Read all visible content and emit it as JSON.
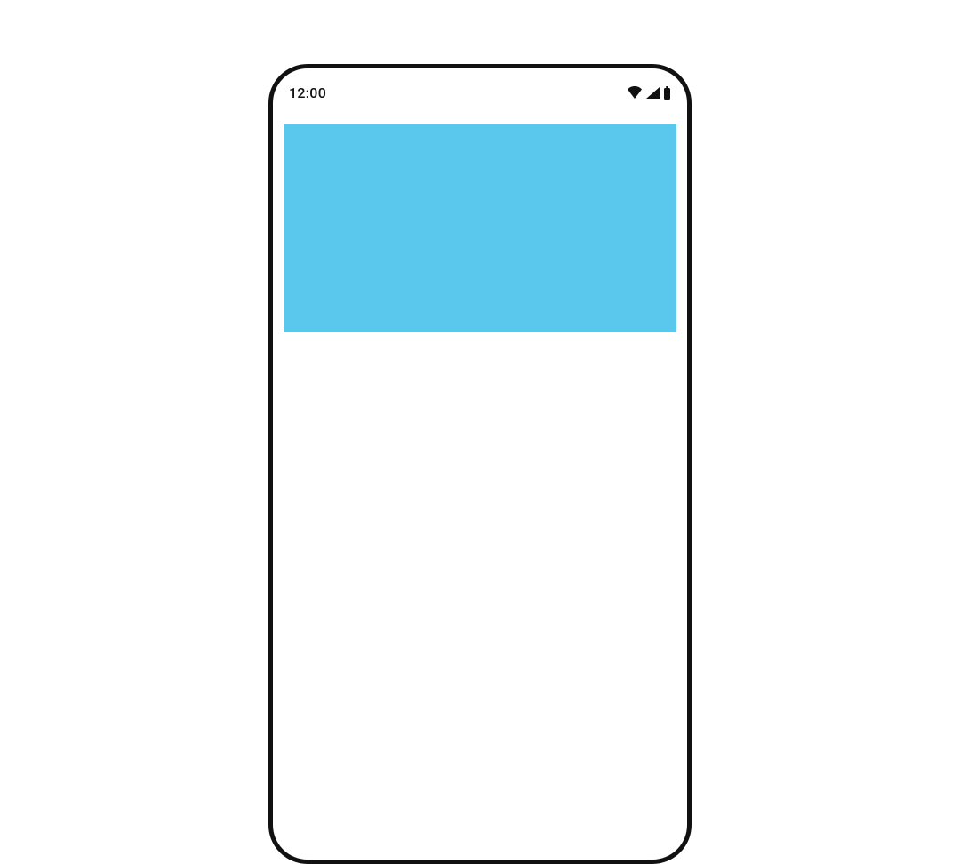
{
  "status_bar": {
    "time": "12:00"
  },
  "content": {
    "block_color": "#5ac8ed"
  }
}
